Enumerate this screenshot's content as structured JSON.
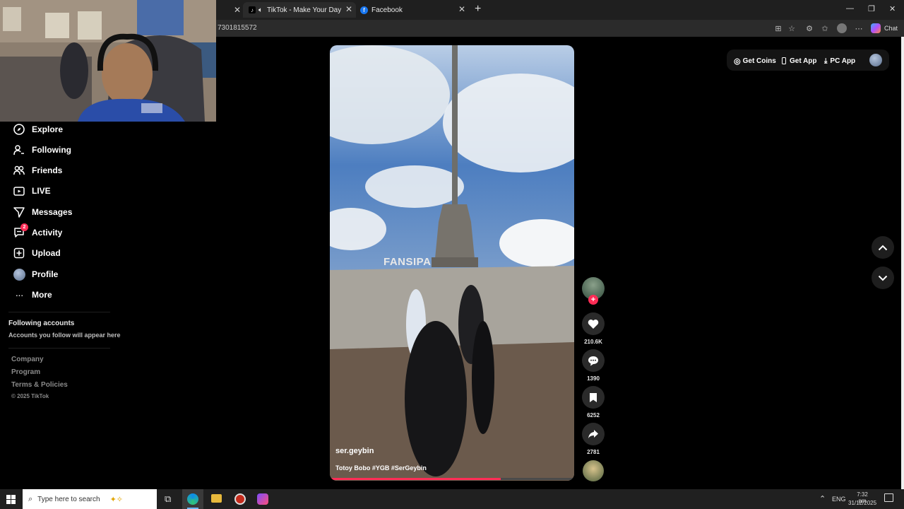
{
  "browser": {
    "tabs": [
      {
        "label": "TikTok - Make Your Day"
      },
      {
        "label": "Facebook"
      }
    ],
    "new_tab": "+",
    "url_fragment": "7301815572",
    "chat_label": "Chat"
  },
  "top_actions": {
    "get_coins": "Get Coins",
    "get_app": "Get App",
    "pc_app": "PC App"
  },
  "sidebar": {
    "items": [
      {
        "label": "Explore",
        "icon": "compass-icon"
      },
      {
        "label": "Following",
        "icon": "person-follow-icon"
      },
      {
        "label": "Friends",
        "icon": "friends-icon"
      },
      {
        "label": "LIVE",
        "icon": "live-tv-icon"
      },
      {
        "label": "Messages",
        "icon": "send-icon"
      },
      {
        "label": "Activity",
        "icon": "activity-icon",
        "badge": "2"
      },
      {
        "label": "Upload",
        "icon": "plus-square-icon"
      },
      {
        "label": "Profile",
        "icon": "avatar-icon"
      },
      {
        "label": "More",
        "icon": "ellipsis-icon"
      }
    ],
    "following_title": "Following accounts",
    "following_hint": "Accounts you follow will appear here",
    "footer": [
      "Company",
      "Program",
      "Terms & Policies",
      "© 2025 TikTok"
    ]
  },
  "video": {
    "sign_text": "FANSIPA",
    "username": "ser.geybin",
    "caption": "Totoy Bobo #YGB #SerGeybin",
    "progress": 0.7
  },
  "actions": {
    "likes": "210.6K",
    "comments": "1390",
    "saves": "6252",
    "shares": "2781"
  },
  "taskbar": {
    "search_placeholder": "Type here to search",
    "lang": "ENG",
    "time": "7:32 pm",
    "date": "31/12/2025"
  },
  "colors": {
    "accent": "#fe2c55",
    "background": "#000000"
  }
}
